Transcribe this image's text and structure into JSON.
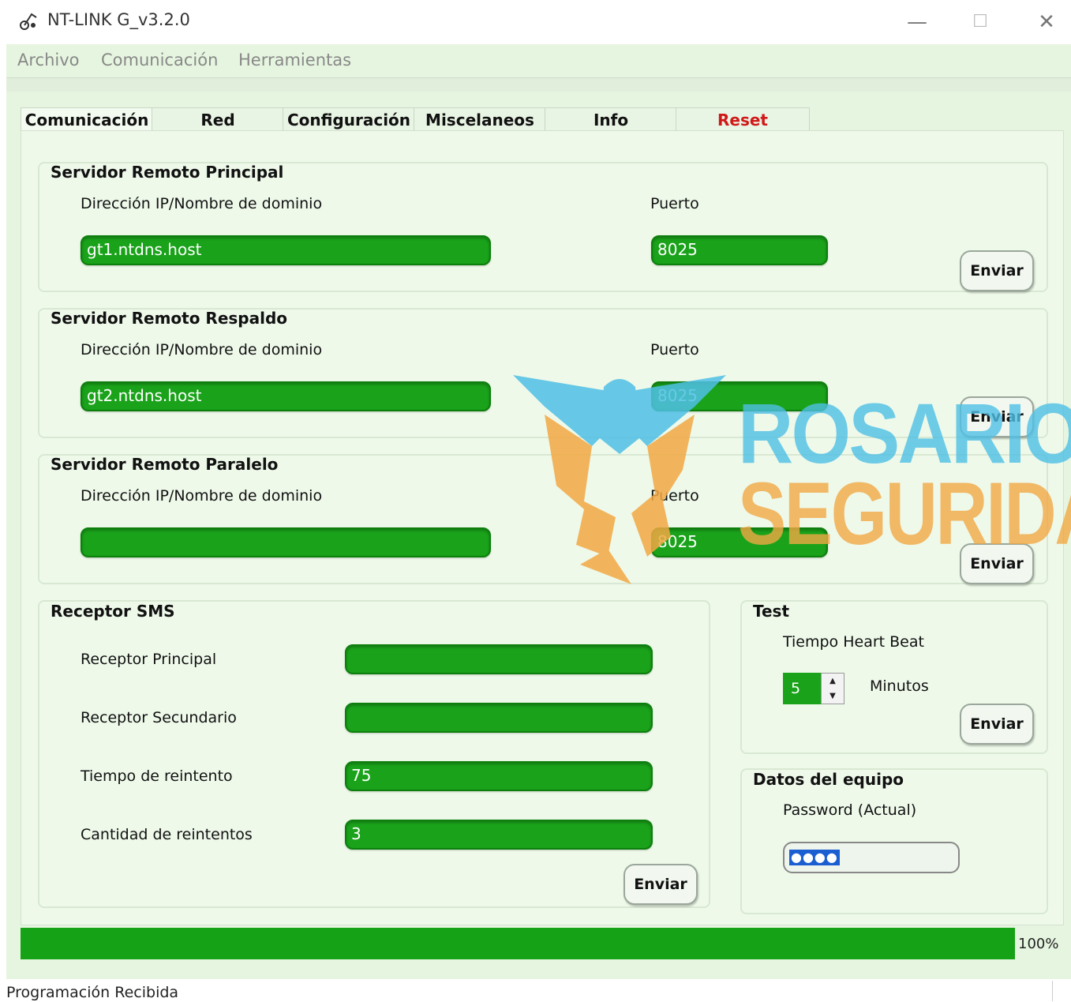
{
  "window": {
    "title": "NT-LINK G_v3.2.0",
    "controls": {
      "minimize": "—",
      "maximize": "☐",
      "close": "✕"
    }
  },
  "menu": [
    "Archivo",
    "Comunicación",
    "Herramientas"
  ],
  "tabs": [
    {
      "label": "Comunicación",
      "active": true
    },
    {
      "label": "Red"
    },
    {
      "label": "Configuración"
    },
    {
      "label": "Miscelaneos"
    },
    {
      "label": "Info"
    },
    {
      "label": "Reset",
      "color": "#d01818"
    }
  ],
  "servers": [
    {
      "title": "Servidor Remoto Principal",
      "host_label": "Dirección IP/Nombre de dominio",
      "host": "gt1.ntdns.host",
      "port_label": "Puerto",
      "port": "8025",
      "send": "Enviar"
    },
    {
      "title": "Servidor Remoto Respaldo",
      "host_label": "Dirección IP/Nombre de dominio",
      "host": "gt2.ntdns.host",
      "port_label": "Puerto",
      "port": "8025",
      "send": "Enviar"
    },
    {
      "title": "Servidor Remoto Paralelo",
      "host_label": "Dirección IP/Nombre de dominio",
      "host": "",
      "port_label": "Puerto",
      "port": "8025",
      "send": "Enviar"
    }
  ],
  "sms": {
    "title": "Receptor SMS",
    "fields": [
      {
        "label": "Receptor Principal",
        "value": ""
      },
      {
        "label": "Receptor Secundario",
        "value": ""
      },
      {
        "label": "Tiempo de reintento",
        "value": "75"
      },
      {
        "label": "Cantidad de reintentos",
        "value": "3"
      }
    ],
    "send": "Enviar"
  },
  "test": {
    "title": "Test",
    "heartbeat_label": "Tiempo Heart Beat",
    "heartbeat_value": "5",
    "unit": "Minutos",
    "send": "Enviar"
  },
  "device": {
    "title": "Datos del equipo",
    "password_label": "Password (Actual)",
    "password_mask": "●●●●"
  },
  "progress": {
    "value": 1.0,
    "label": "100%"
  },
  "status": "Programación Recibida",
  "watermark": {
    "line1": "ROSARIO",
    "line2": "SEGURIDA"
  },
  "colors": {
    "field_green": "#1aa31a",
    "panel_bg": "#e6f5e0",
    "reset_red": "#d01818",
    "wm_blue": "#4fc0e6",
    "wm_orange": "#f2a944"
  }
}
